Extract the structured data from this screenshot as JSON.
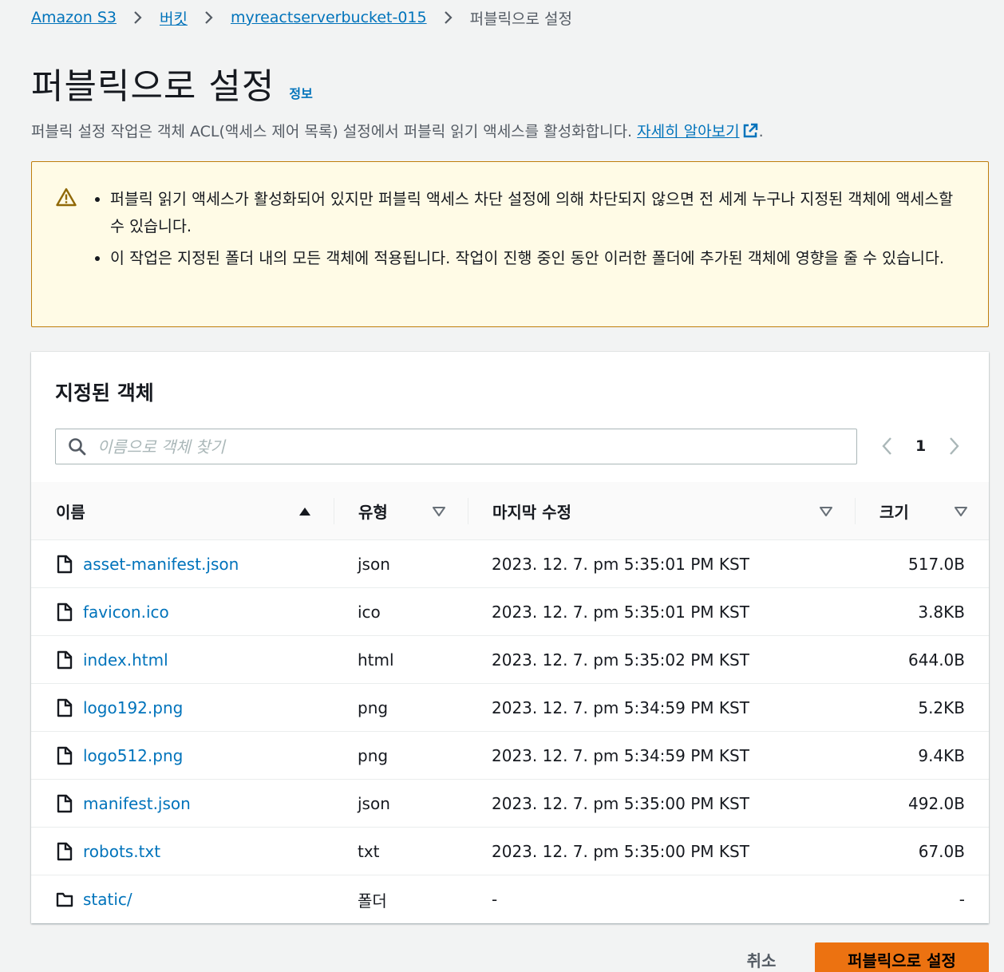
{
  "breadcrumb": {
    "items": [
      "Amazon S3",
      "버킷",
      "myreactserverbucket-015"
    ],
    "current": "퍼블릭으로 설정"
  },
  "header": {
    "title": "퍼블릭으로 설정",
    "info": "정보",
    "description": "퍼블릭 설정 작업은 객체 ACL(액세스 제어 목록) 설정에서 퍼블릭 읽기 액세스를 활성화합니다.",
    "learn_more": "자세히 알아보기",
    "period": "."
  },
  "warning": {
    "items": [
      "퍼블릭 읽기 액세스가 활성화되어 있지만 퍼블릭 액세스 차단 설정에 의해 차단되지 않으면 전 세계 누구나 지정된 객체에 액세스할 수 있습니다.",
      "이 작업은 지정된 폴더 내의 모든 객체에 적용됩니다. 작업이 진행 중인 동안 이러한 폴더에 추가된 객체에 영향을 줄 수 있습니다."
    ]
  },
  "panel": {
    "title": "지정된 객체",
    "search_placeholder": "이름으로 객체 찾기",
    "page": "1"
  },
  "table": {
    "columns": [
      "이름",
      "유형",
      "마지막 수정",
      "크기"
    ],
    "rows": [
      {
        "name": "asset-manifest.json",
        "type": "json",
        "modified": "2023. 12. 7. pm 5:35:01 PM KST",
        "size": "517.0B",
        "icon": "file-icon"
      },
      {
        "name": "favicon.ico",
        "type": "ico",
        "modified": "2023. 12. 7. pm 5:35:01 PM KST",
        "size": "3.8KB",
        "icon": "file-icon"
      },
      {
        "name": "index.html",
        "type": "html",
        "modified": "2023. 12. 7. pm 5:35:02 PM KST",
        "size": "644.0B",
        "icon": "file-icon"
      },
      {
        "name": "logo192.png",
        "type": "png",
        "modified": "2023. 12. 7. pm 5:34:59 PM KST",
        "size": "5.2KB",
        "icon": "file-icon"
      },
      {
        "name": "logo512.png",
        "type": "png",
        "modified": "2023. 12. 7. pm 5:34:59 PM KST",
        "size": "9.4KB",
        "icon": "file-icon"
      },
      {
        "name": "manifest.json",
        "type": "json",
        "modified": "2023. 12. 7. pm 5:35:00 PM KST",
        "size": "492.0B",
        "icon": "file-icon"
      },
      {
        "name": "robots.txt",
        "type": "txt",
        "modified": "2023. 12. 7. pm 5:35:00 PM KST",
        "size": "67.0B",
        "icon": "file-icon"
      },
      {
        "name": "static/",
        "type": "폴더",
        "modified": "-",
        "size": "-",
        "icon": "folder-icon"
      }
    ]
  },
  "footer": {
    "cancel": "취소",
    "submit": "퍼블릭으로 설정"
  },
  "colors": {
    "link": "#0073bb",
    "primary": "#ec7211",
    "warning_bg": "#fffbe6",
    "warning_border": "#bf7e0c"
  }
}
